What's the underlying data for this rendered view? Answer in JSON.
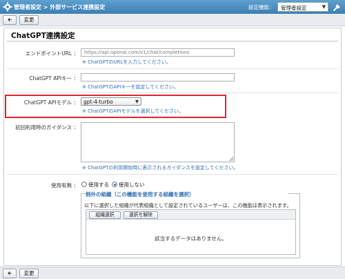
{
  "header": {
    "title": "管理者設定 > 外部サービス連携設定",
    "function_label": "設定機能：",
    "function_selected": "管理者設定"
  },
  "toolbar": {
    "back_symbol": "🡰",
    "change_label": "変更"
  },
  "panel": {
    "title": "ChatGPT連携設定"
  },
  "endpoint": {
    "label": "エンドポイントURL ：",
    "value": "https://api.openai.com/v1/chat/completions",
    "hint": "※ ChatGPTのURLを入力してください。"
  },
  "apikey": {
    "label": "ChatGPT APIキー ：",
    "value": "",
    "hint": "※ ChatGPTのAPIキーを設定してください。"
  },
  "model": {
    "label": "ChatGPT APIモデル ：",
    "selected": "gpt-4-turbo",
    "hint": "※ ChatGPTのAPIモデルを選択してください。"
  },
  "guidance": {
    "label": "初回利用時のガイダンス ：",
    "hint": "※ ChatGPTの利用開始時に表示されるガイダンスを設定してください。"
  },
  "enabled": {
    "label": "使用有無 ：",
    "option_use": "使用する",
    "option_nouse": "使用しない",
    "selected": "使用しない"
  },
  "exceptions": {
    "legend": "例外の組織（この機能を使用する組織を選択）",
    "description": "以下に選択した組織が代表組織として設定されているユーザーは、この機能は表示されます。",
    "select_button": "組織選択",
    "clear_button": "選択を解除",
    "empty_message": "該当するデータはありません。"
  },
  "colors": {
    "accent": "#3c7fb4",
    "highlight": "#e3232c",
    "hint": "#2f6fb6"
  },
  "icons": {
    "header_left": "gear-icon",
    "header_right": "wrench-icon"
  }
}
